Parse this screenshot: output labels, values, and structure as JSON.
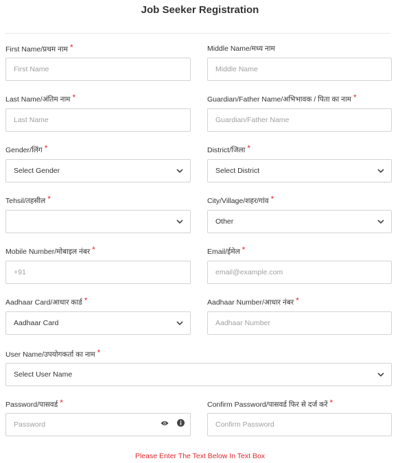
{
  "page": {
    "title": "Job Seeker Registration"
  },
  "required_mark": "*",
  "fields": {
    "first_name": {
      "label": "First Name/प्रथम नाम",
      "placeholder": "First Name",
      "required": true
    },
    "middle_name": {
      "label": "Middle Name/मध्य नाम",
      "placeholder": "Middle Name",
      "required": false
    },
    "last_name": {
      "label": "Last Name/अंतिम नाम",
      "placeholder": "Last Name",
      "required": true
    },
    "guardian_name": {
      "label": "Guardian/Father Name/अभिभावक / पिता का नाम",
      "placeholder": "Guardian/Father Name",
      "required": true
    },
    "gender": {
      "label": "Gender/लिंग",
      "value": "Select Gender",
      "required": true
    },
    "district": {
      "label": "District/जिला",
      "value": "Select District",
      "required": true
    },
    "tehsil": {
      "label": "Tehsil/तहसील",
      "value": "",
      "required": true
    },
    "city": {
      "label": "City/Village/शहर/गांव",
      "value": "Other",
      "required": true
    },
    "mobile": {
      "label": "Mobile Number/मोबाइल नंबर",
      "placeholder": "+91",
      "required": true
    },
    "email": {
      "label": "Email/ईमेल",
      "placeholder": "email@example.com",
      "required": true
    },
    "aadhaar_card": {
      "label": "Aadhaar Card/आधार कार्ड",
      "value": "Aadhaar Card",
      "required": true
    },
    "aadhaar_number": {
      "label": "Aadhaar Number/आधार नंबर",
      "placeholder": "Aadhaar Number",
      "required": true
    },
    "user_name": {
      "label": "User Name/उपयोगकर्ता का नाम",
      "value": "Select User Name",
      "required": true
    },
    "password": {
      "label": "Password/पासवर्ड",
      "placeholder": "Password",
      "required": true
    },
    "confirm_password": {
      "label": "Confirm Password/पासवर्ड फिर से दर्ज करें",
      "placeholder": "Confirm Password",
      "required": true
    }
  },
  "icons": {
    "select": "chevron-down-icon",
    "password_toggle": "eye-icon",
    "password_info": "info-icon"
  },
  "captcha_note": "Please Enter The Text Below In Text Box",
  "colors": {
    "required": "#e0282e",
    "border": "#d3d3d3",
    "placeholder": "#a0a0a0",
    "note": "#e0282e"
  }
}
